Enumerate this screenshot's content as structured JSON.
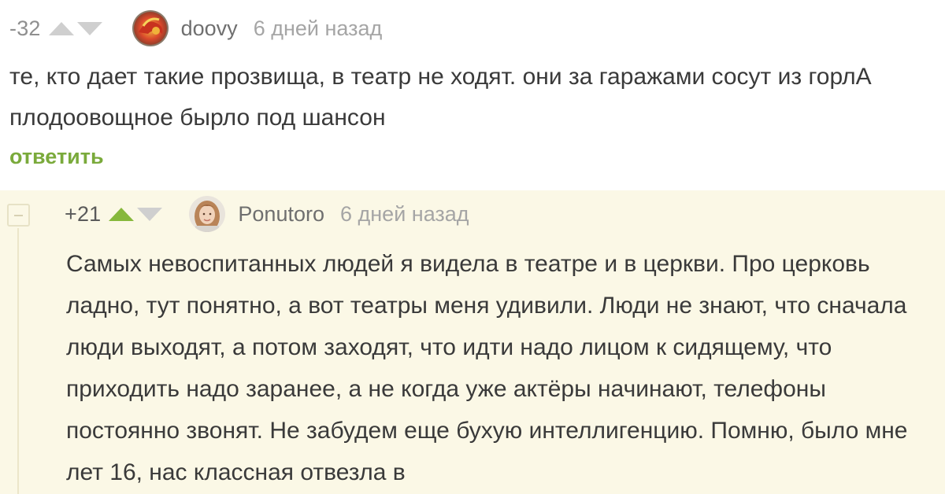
{
  "comments": [
    {
      "rating": "-32",
      "username": "doovy",
      "time": "6 дней назад",
      "text": "те, кто дает такие прозвища, в театр не ходят. они за гаражами сосут из горлА плодоовощное бырло под шансон",
      "reply_label": "ответить"
    },
    {
      "rating": "+21",
      "username": "Ponutoro",
      "time": "6 дней назад",
      "text": "Самых невоспитанных людей я видела в театре и в церкви. Про церковь ладно, тут понятно, а вот театры меня удивили. Люди не знают, что сначала люди выходят, а потом заходят, что идти надо лицом к сидящему, что приходить надо заранее, а не когда уже актёры начинают, телефоны постоянно звонят. Не забудем еще бухую интеллигенцию. Помню, было мне лет 16, нас классная отвезла в"
    }
  ],
  "colors": {
    "upvote_active": "#86b83b",
    "vote_inactive": "#cfcfcf",
    "reply_link": "#7aaa3b",
    "nested_background": "#fbf8e6"
  },
  "icons": {
    "upvote": "triangle-up-icon",
    "downvote": "triangle-down-icon",
    "collapse": "minus-square-icon"
  }
}
